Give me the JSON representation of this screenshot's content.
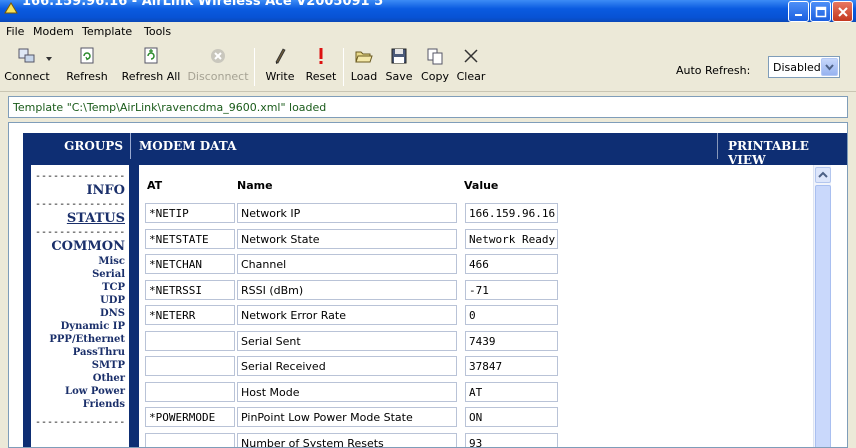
{
  "window": {
    "title": "166.159.96.16 - AirLink Wireless Ace V2005091 5"
  },
  "menu": [
    "File",
    "Modem",
    "Template",
    "Tools"
  ],
  "toolbar": {
    "connect": "Connect",
    "refresh": "Refresh",
    "refresh_all": "Refresh All",
    "disconnect": "Disconnect",
    "write": "Write",
    "reset": "Reset",
    "load": "Load",
    "save": "Save",
    "copy": "Copy",
    "clear": "Clear",
    "auto_refresh_label": "Auto Refresh:",
    "auto_refresh_value": "Disabled"
  },
  "status_message": "Template \"C:\\Temp\\AirLink\\ravencdma_9600.xml\" loaded",
  "headers": {
    "groups": "GROUPS",
    "modem_data": "MODEM DATA",
    "printable_view": "PRINTABLE VIEW"
  },
  "groups": {
    "separator": "---------------",
    "info": "INFO",
    "status": "STATUS",
    "common": "COMMON",
    "subitems": [
      "Misc",
      "Serial",
      "TCP",
      "UDP",
      "DNS",
      "Dynamic IP",
      "PPP/Ethernet",
      "PassThru",
      "SMTP",
      "Other",
      "Low Power",
      "Friends"
    ]
  },
  "table": {
    "col_at": "AT",
    "col_name": "Name",
    "col_value": "Value",
    "rows": [
      {
        "at": "*NETIP",
        "name": "Network IP",
        "value": "166.159.96.16"
      },
      {
        "at": "*NETSTATE",
        "name": "Network State",
        "value": "Network Ready"
      },
      {
        "at": "*NETCHAN",
        "name": "Channel",
        "value": "466"
      },
      {
        "at": "*NETRSSI",
        "name": "RSSI (dBm)",
        "value": "-71"
      },
      {
        "at": "*NETERR",
        "name": "Network Error Rate",
        "value": "0"
      },
      {
        "at": "",
        "name": "Serial Sent",
        "value": "7439"
      },
      {
        "at": "",
        "name": "Serial Received",
        "value": "37847"
      },
      {
        "at": "",
        "name": "Host Mode",
        "value": "AT"
      },
      {
        "at": "*POWERMODE",
        "name": "PinPoint Low Power Mode State",
        "value": "ON"
      },
      {
        "at": "",
        "name": "Number of System Resets",
        "value": "93"
      }
    ]
  },
  "colors": {
    "titlebar": "#0a5be0",
    "header_band": "#0e2e73",
    "group_text": "#1a2f6a",
    "status_text": "#1a5b1a"
  }
}
